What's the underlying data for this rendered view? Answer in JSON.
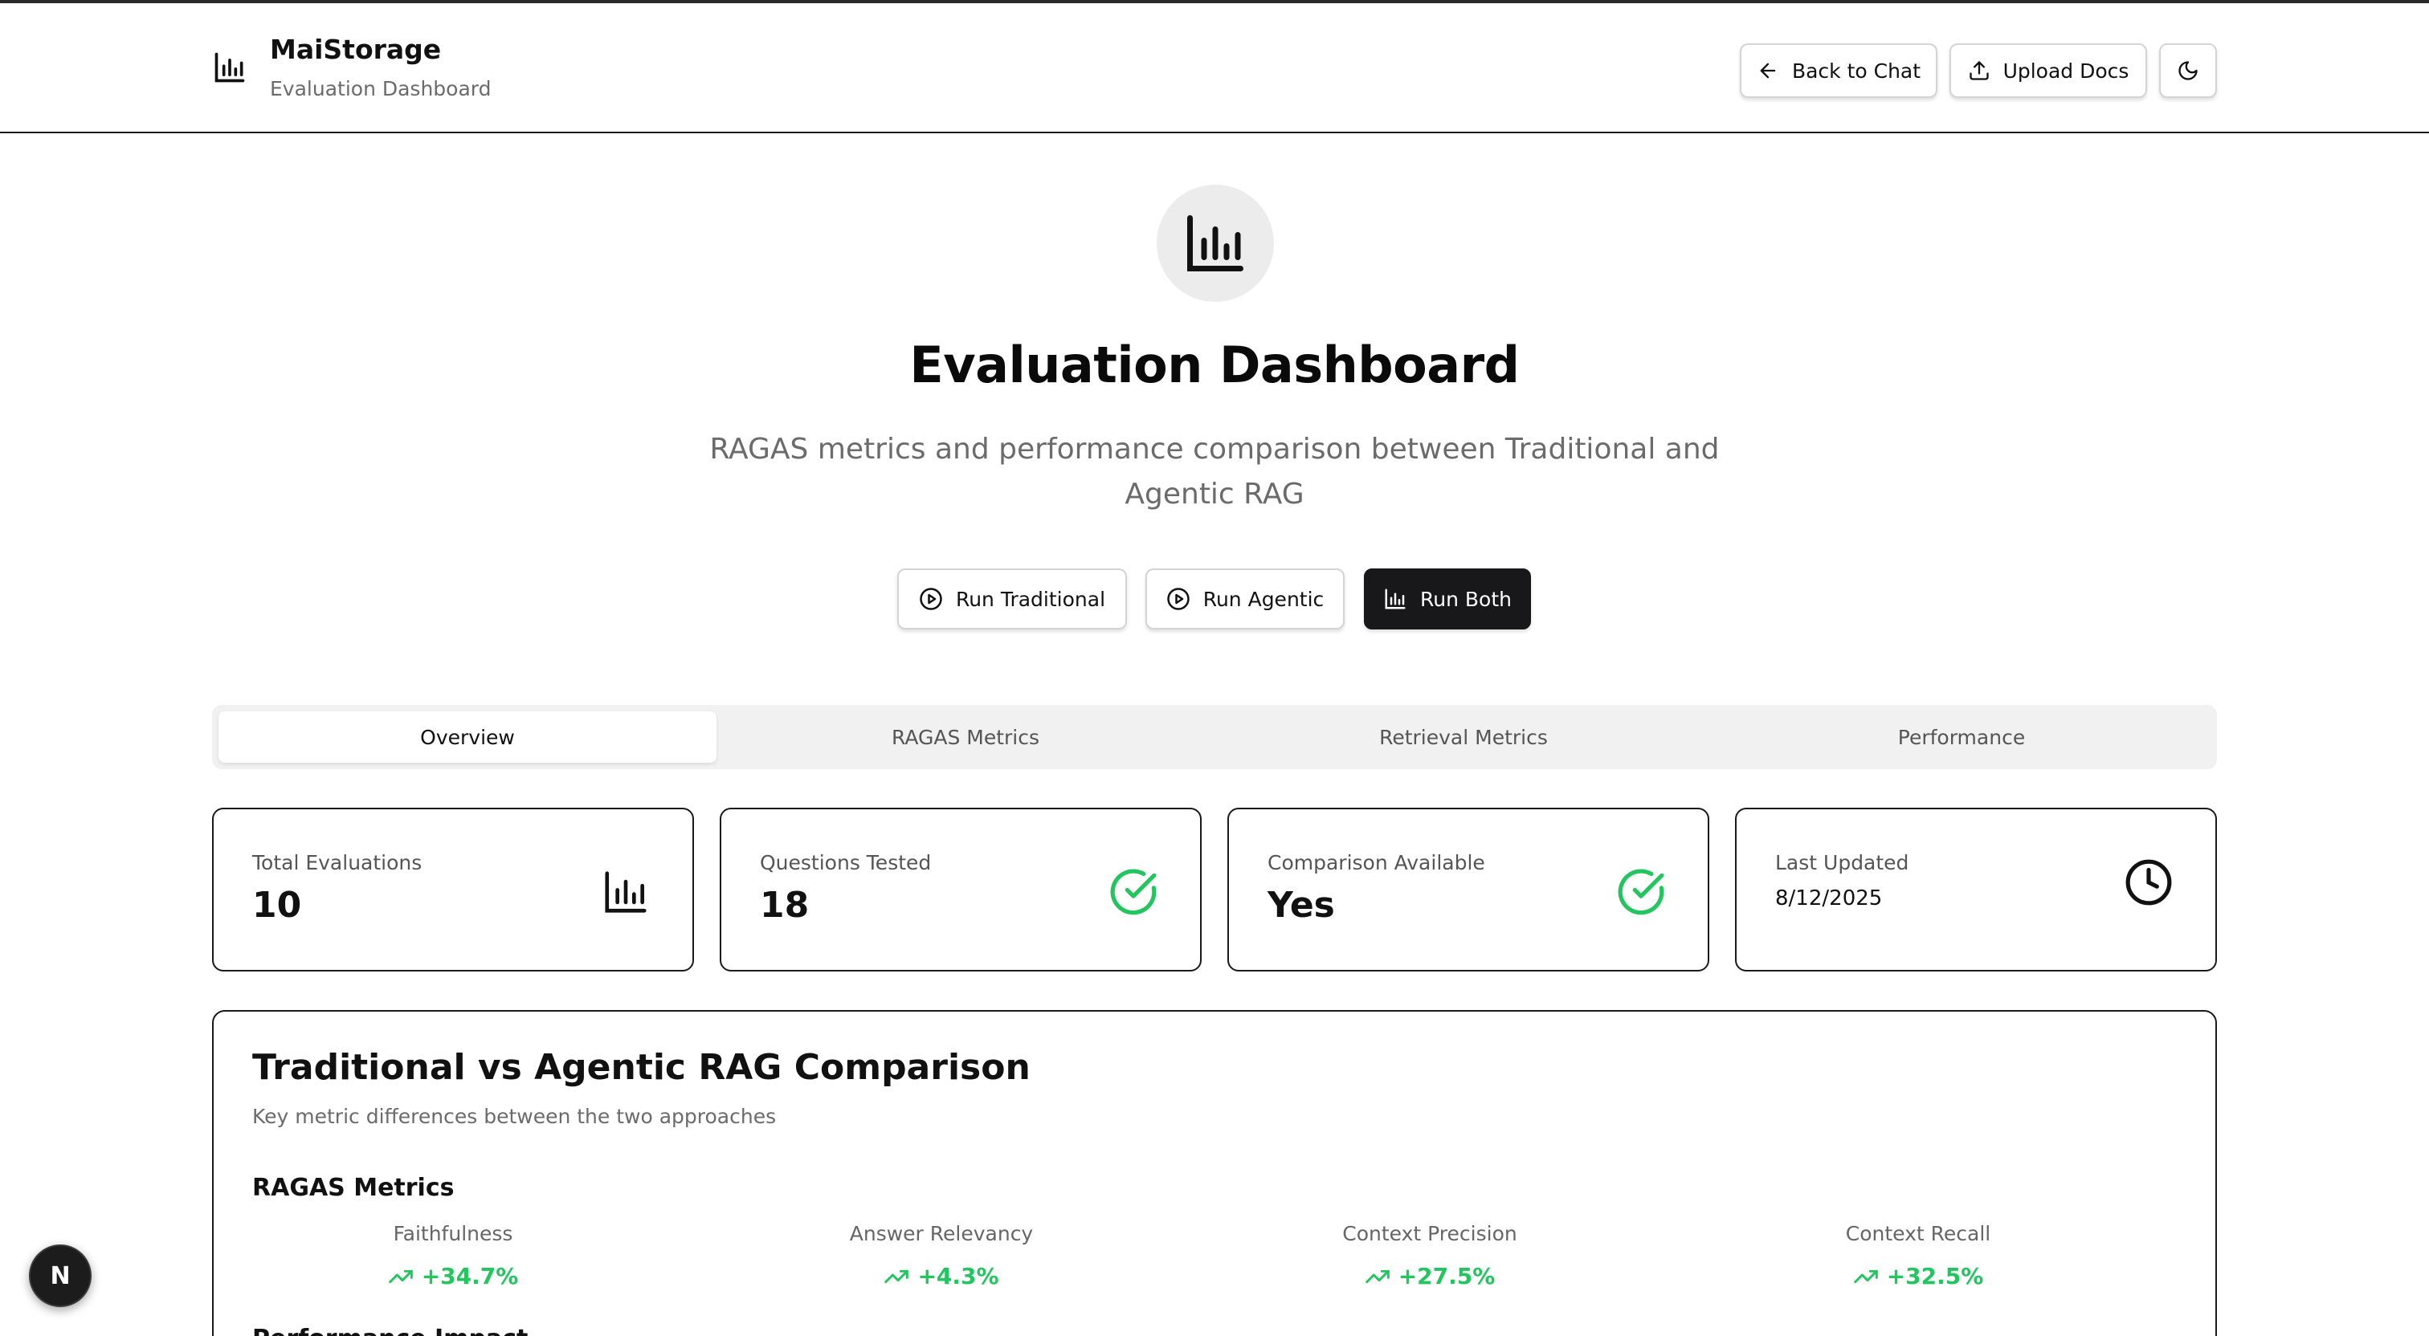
{
  "header": {
    "app_name": "MaiStorage",
    "app_subtitle": "Evaluation Dashboard",
    "back_label": "Back to Chat",
    "upload_label": "Upload Docs"
  },
  "hero": {
    "title": "Evaluation Dashboard",
    "description": "RAGAS metrics and performance comparison between Traditional and Agentic RAG"
  },
  "actions": {
    "run_traditional": "Run Traditional",
    "run_agentic": "Run Agentic",
    "run_both": "Run Both"
  },
  "tabs": [
    {
      "label": "Overview",
      "active": true
    },
    {
      "label": "RAGAS Metrics",
      "active": false
    },
    {
      "label": "Retrieval Metrics",
      "active": false
    },
    {
      "label": "Performance",
      "active": false
    }
  ],
  "stats": [
    {
      "label": "Total Evaluations",
      "value": "10",
      "icon": "bar-chart-icon"
    },
    {
      "label": "Questions Tested",
      "value": "18",
      "icon": "check-circle-icon"
    },
    {
      "label": "Comparison Available",
      "value": "Yes",
      "icon": "check-circle-icon"
    },
    {
      "label": "Last Updated",
      "value": "8/12/2025",
      "icon": "clock-icon"
    }
  ],
  "comparison": {
    "title": "Traditional vs Agentic RAG Comparison",
    "subtitle": "Key metric differences between the two approaches",
    "section_title": "RAGAS Metrics",
    "metrics": [
      {
        "name": "Faithfulness",
        "delta": "+34.7%"
      },
      {
        "name": "Answer Relevancy",
        "delta": "+4.3%"
      },
      {
        "name": "Context Precision",
        "delta": "+27.5%"
      },
      {
        "name": "Context Recall",
        "delta": "+32.5%"
      }
    ],
    "next_section_title": "Performance Impact"
  },
  "badge": {
    "label": "N"
  },
  "colors": {
    "accent_dark": "#18181b",
    "success": "#22c55e",
    "muted_text": "#6b6b6b"
  }
}
